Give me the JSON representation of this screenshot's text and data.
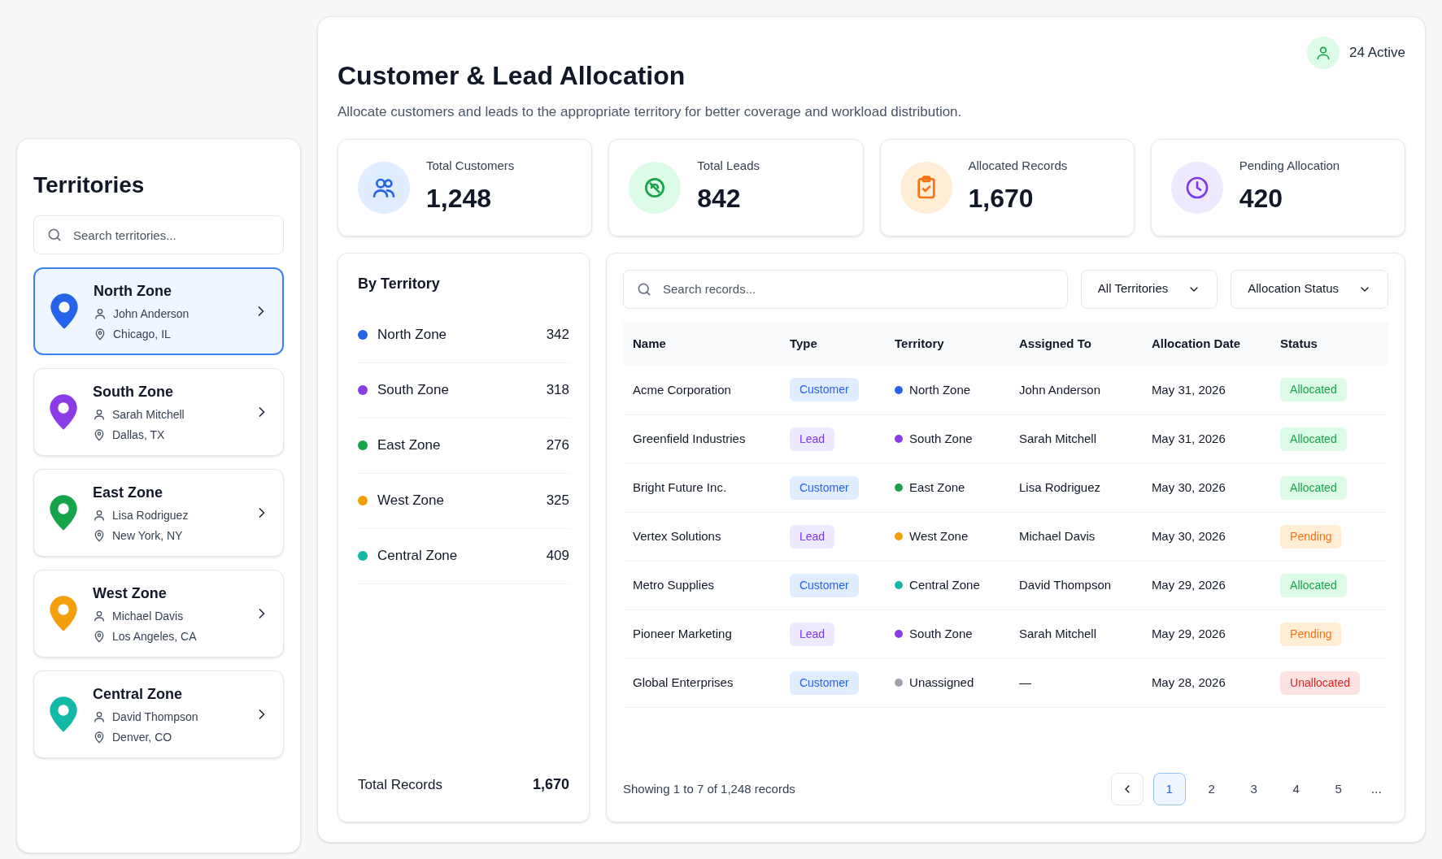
{
  "territories_panel": {
    "title": "Territories",
    "search": {
      "placeholder": "Search territories..."
    },
    "items": [
      {
        "name": "North Zone",
        "manager": "John Anderson",
        "location": "Chicago, IL",
        "color": "#2563eb",
        "selected": true
      },
      {
        "name": "South Zone",
        "manager": "Sarah Mitchell",
        "location": "Dallas, TX",
        "color": "#8b3ce6",
        "selected": false
      },
      {
        "name": "East Zone",
        "manager": "Lisa Rodriguez",
        "location": "New York, NY",
        "color": "#16a34a",
        "selected": false
      },
      {
        "name": "West Zone",
        "manager": "Michael Davis",
        "location": "Los Angeles, CA",
        "color": "#f59e0b",
        "selected": false
      },
      {
        "name": "Central Zone",
        "manager": "David Thompson",
        "location": "Denver, CO",
        "color": "#14b8a6",
        "selected": false
      }
    ]
  },
  "header": {
    "title": "Customer & Lead Allocation",
    "subtitle": "Allocate customers and leads to the appropriate territory for better coverage and workload distribution.",
    "active_badge": "24 Active"
  },
  "stats": [
    {
      "kind": "customers",
      "label": "Total Customers",
      "value": "1,248"
    },
    {
      "kind": "leads",
      "label": "Total Leads",
      "value": "842"
    },
    {
      "kind": "records",
      "label": "Allocated Records",
      "value": "1,670"
    },
    {
      "kind": "pending",
      "label": "Pending Allocation",
      "value": "420"
    }
  ],
  "by_territory": {
    "title": "By Territory",
    "rows": [
      {
        "name": "North Zone",
        "count": "342",
        "color": "#2563eb"
      },
      {
        "name": "South Zone",
        "count": "318",
        "color": "#8b3ce6"
      },
      {
        "name": "East Zone",
        "count": "276",
        "color": "#16a34a"
      },
      {
        "name": "West Zone",
        "count": "325",
        "color": "#f59e0b"
      },
      {
        "name": "Central Zone",
        "count": "409",
        "color": "#14b8a6"
      }
    ],
    "total_label": "Total Records",
    "total_value": "1,670"
  },
  "records": {
    "search": {
      "placeholder": "Search records..."
    },
    "filters": [
      "All Territories",
      "Allocation Status"
    ],
    "columns": [
      "Name",
      "Type",
      "Territory",
      "Assigned To",
      "Allocation Date",
      "Status"
    ],
    "rows": [
      {
        "name": "Acme Corporation",
        "type": {
          "kind": "customer",
          "label": "Customer"
        },
        "territory": "North Zone",
        "color": "#2563eb",
        "assigned": "John Anderson",
        "date": "May 31, 2026",
        "status": {
          "kind": "allocated",
          "label": "Allocated"
        }
      },
      {
        "name": "Greenfield Industries",
        "type": {
          "kind": "lead",
          "label": "Lead"
        },
        "territory": "South Zone",
        "color": "#8b3ce6",
        "assigned": "Sarah Mitchell",
        "date": "May 31, 2026",
        "status": {
          "kind": "allocated",
          "label": "Allocated"
        }
      },
      {
        "name": "Bright Future Inc.",
        "type": {
          "kind": "customer",
          "label": "Customer"
        },
        "territory": "East Zone",
        "color": "#16a34a",
        "assigned": "Lisa Rodriguez",
        "date": "May 30, 2026",
        "status": {
          "kind": "allocated",
          "label": "Allocated"
        }
      },
      {
        "name": "Vertex Solutions",
        "type": {
          "kind": "lead",
          "label": "Lead"
        },
        "territory": "West Zone",
        "color": "#f59e0b",
        "assigned": "Michael Davis",
        "date": "May 30, 2026",
        "status": {
          "kind": "pending",
          "label": "Pending"
        }
      },
      {
        "name": "Metro Supplies",
        "type": {
          "kind": "customer",
          "label": "Customer"
        },
        "territory": "Central Zone",
        "color": "#14b8a6",
        "assigned": "David Thompson",
        "date": "May 29, 2026",
        "status": {
          "kind": "allocated",
          "label": "Allocated"
        }
      },
      {
        "name": "Pioneer Marketing",
        "type": {
          "kind": "lead",
          "label": "Lead"
        },
        "territory": "South Zone",
        "color": "#8b3ce6",
        "assigned": "Sarah Mitchell",
        "date": "May 29, 2026",
        "status": {
          "kind": "pending",
          "label": "Pending"
        }
      },
      {
        "name": "Global Enterprises",
        "type": {
          "kind": "customer",
          "label": "Customer"
        },
        "territory": "Unassigned",
        "color": "#9ca3af",
        "assigned": "—",
        "date": "May 28, 2026",
        "status": {
          "kind": "unallocated",
          "label": "Unallocated"
        }
      }
    ],
    "showing": "Showing 1 to 7 of 1,248 records",
    "pages": [
      {
        "label": "1",
        "selected": true
      },
      {
        "label": "2",
        "selected": false
      },
      {
        "label": "3",
        "selected": false
      },
      {
        "label": "4",
        "selected": false
      },
      {
        "label": "5",
        "selected": false
      }
    ],
    "more": "..."
  }
}
